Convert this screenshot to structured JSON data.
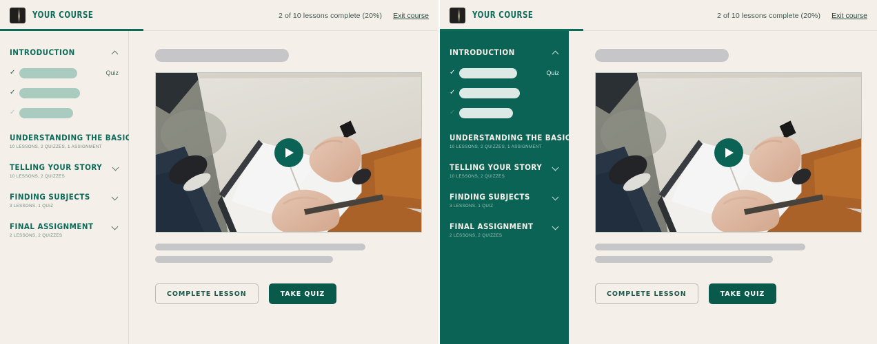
{
  "header": {
    "logo_icon": "course-logo-icon",
    "brand": "YOUR COURSE",
    "progress": "2 of 10 lessons complete (20%)",
    "exit_label": "Exit course",
    "accent_color": "#0d6b5a"
  },
  "sidebar": {
    "expanded_section": {
      "title": "INTRODUCTION",
      "chevron": "chevron-up-icon",
      "lessons": [
        {
          "state": "done",
          "check": "✓",
          "tag": "Quiz"
        },
        {
          "state": "done",
          "check": "✓",
          "tag": ""
        },
        {
          "state": "todo",
          "check": "✓",
          "tag": ""
        }
      ]
    },
    "sections": [
      {
        "title": "UNDERSTANDING THE BASICS",
        "subtitle": "10 LESSONS, 2 QUIZZES, 1 ASSIGNMENT",
        "chevron": "chevron-down-icon"
      },
      {
        "title": "TELLING YOUR STORY",
        "subtitle": "10 LESSONS, 2 QUIZZES",
        "chevron": "chevron-down-icon"
      },
      {
        "title": "FINDING SUBJECTS",
        "subtitle": "3 LESSONS, 1 QUIZ",
        "chevron": "chevron-down-icon"
      },
      {
        "title": "FINAL ASSIGNMENT",
        "subtitle": "2 LESSONS, 2 QUIZZES",
        "chevron": "chevron-down-icon"
      }
    ],
    "theme_light_bg": "#f4efe9",
    "theme_dark_bg": "#0a6354"
  },
  "main": {
    "video": {
      "play_icon": "play-button-icon",
      "alt": "overhead photo of hands writing in a notebook"
    },
    "buttons": {
      "complete": "COMPLETE LESSON",
      "quiz": "TAKE QUIZ"
    }
  },
  "colors": {
    "page_bg": "#f4efe9",
    "brand_green": "#0d6b5a",
    "dark_green": "#0a6354",
    "sage": "#a9cbc0",
    "skeleton_gray": "#c6c5c8"
  }
}
